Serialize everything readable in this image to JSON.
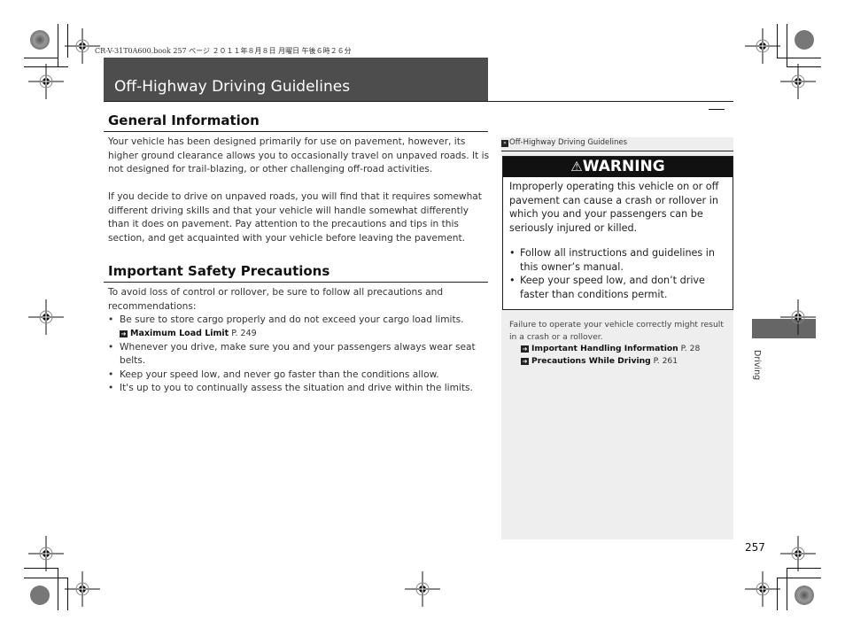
{
  "print_header": "CR-V-31T0A600.book  257 ページ  ２０１１年８月８日  月曜日  午後６時２６分",
  "page_title": "Off-Highway Driving Guidelines",
  "general_info": {
    "heading": "General Information",
    "paragraphs": [
      "Your vehicle has been designed primarily for use on pavement, however, its higher ground clearance allows you to occasionally travel on unpaved roads. It is not designed for trail-blazing, or other challenging off-road activities.",
      "If you decide to drive on unpaved roads, you will find that it requires somewhat different driving skills and that your vehicle will handle somewhat differently than it does on pavement. Pay attention to the precautions and tips in this section, and get acquainted with your vehicle before leaving the pavement."
    ]
  },
  "safety": {
    "heading": "Important Safety Precautions",
    "intro": "To avoid loss of control or rollover, be sure to follow all precautions and recommendations:",
    "bullets": [
      "Be sure to store cargo properly and do not exceed your cargo load limits.",
      "Whenever you drive, make sure you and your passengers always wear seat belts.",
      "Keep your speed low, and never go faster than the conditions allow.",
      "It's up to you to continually assess the situation and drive within the limits."
    ],
    "xref": {
      "icon": "arrow-ref-icon",
      "label": "Maximum Load Limit",
      "page": "P. 249"
    }
  },
  "sidebar": {
    "heading_icon": "double-chevron-icon",
    "heading": "Off-Highway Driving Guidelines",
    "warning": {
      "icon": "warning-triangle-icon",
      "title": "WARNING",
      "body": "Improperly operating this vehicle on or off pavement can cause a crash or rollover in which you and your passengers can be seriously injured or killed.",
      "bullets": [
        "Follow all instructions and guidelines in this owner’s manual.",
        "Keep your speed low, and don’t drive faster than conditions permit."
      ]
    },
    "note": "Failure to operate your vehicle correctly might result in a crash or a rollover.",
    "xrefs": [
      {
        "label": "Important Handling Information",
        "page": "P. 28"
      },
      {
        "label": "Precautions While Driving",
        "page": "P. 261"
      }
    ]
  },
  "section_tab": "Driving",
  "page_number": "257",
  "colors": {
    "title_bar": "#4d4d4d",
    "side_panel": "#eeeeee",
    "warning_header": "#111111",
    "section_tab": "#666666"
  }
}
